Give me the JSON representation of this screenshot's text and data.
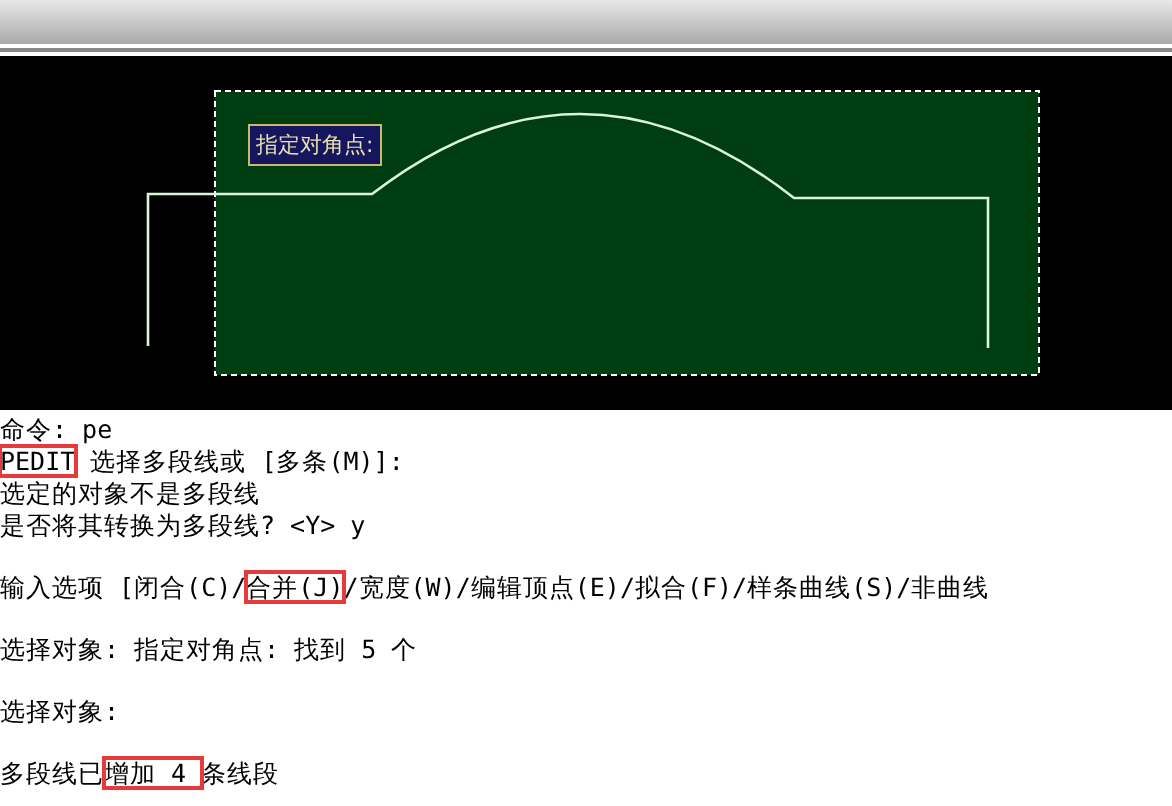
{
  "tooltip": "指定对角点:",
  "command_blocks": [
    [
      [
        {
          "text": "命令: pe",
          "highlighted": false
        }
      ],
      [
        {
          "text": "PEDIT",
          "highlighted": true
        },
        {
          "text": " 选择多段线或 [多条(M)]:",
          "highlighted": false
        }
      ],
      [
        {
          "text": "选定的对象不是多段线",
          "highlighted": false
        }
      ],
      [
        {
          "text": "是否将其转换为多段线? <Y> y",
          "highlighted": false
        }
      ]
    ],
    [
      [
        {
          "text": "输入选项 [闭合(C)/",
          "highlighted": false
        },
        {
          "text": "合并(J)",
          "highlighted": true
        },
        {
          "text": "/宽度(W)/编辑顶点(E)/拟合(F)/样条曲线(S)/非曲线",
          "highlighted": false
        }
      ]
    ],
    [
      [
        {
          "text": "选择对象: 指定对角点: 找到 5 个",
          "highlighted": false
        }
      ]
    ],
    [
      [
        {
          "text": "选择对象:",
          "highlighted": false
        }
      ]
    ],
    [
      [
        {
          "text": "多段线已",
          "highlighted": false
        },
        {
          "text": "增加 4 ",
          "highlighted": true
        },
        {
          "text": "条线段",
          "highlighted": false
        }
      ]
    ]
  ]
}
